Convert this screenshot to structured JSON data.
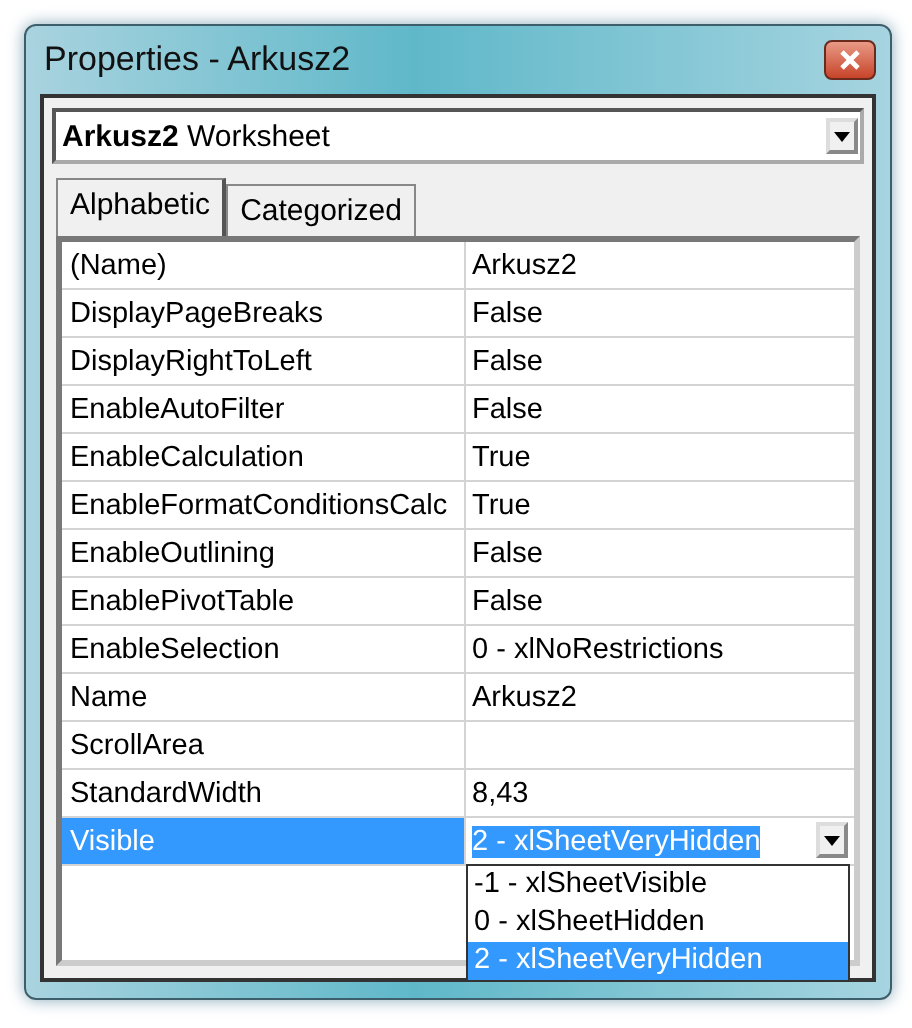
{
  "window": {
    "title": "Properties - Arkusz2"
  },
  "object_selector": {
    "name": "Arkusz2",
    "type": "Worksheet"
  },
  "tabs": [
    {
      "label": "Alphabetic",
      "selected": true
    },
    {
      "label": "Categorized",
      "selected": false
    }
  ],
  "properties": [
    {
      "name": "(Name)",
      "value": "Arkusz2",
      "selected": false
    },
    {
      "name": "DisplayPageBreaks",
      "value": "False",
      "selected": false
    },
    {
      "name": "DisplayRightToLeft",
      "value": "False",
      "selected": false
    },
    {
      "name": "EnableAutoFilter",
      "value": "False",
      "selected": false
    },
    {
      "name": "EnableCalculation",
      "value": "True",
      "selected": false
    },
    {
      "name": "EnableFormatConditionsCalc",
      "value": "True",
      "selected": false
    },
    {
      "name": "EnableOutlining",
      "value": "False",
      "selected": false
    },
    {
      "name": "EnablePivotTable",
      "value": "False",
      "selected": false
    },
    {
      "name": "EnableSelection",
      "value": "0 - xlNoRestrictions",
      "selected": false
    },
    {
      "name": "Name",
      "value": "Arkusz2",
      "selected": false
    },
    {
      "name": "ScrollArea",
      "selected": false
    },
    {
      "name": "StandardWidth",
      "value": "8,43",
      "selected": false
    },
    {
      "name": "Visible",
      "value": "2 - xlSheetVeryHidden",
      "selected": true,
      "options": [
        {
          "label": "-1 - xlSheetVisible",
          "selected": false
        },
        {
          "label": "0 - xlSheetHidden",
          "selected": false
        },
        {
          "label": "2 - xlSheetVeryHidden",
          "selected": true
        }
      ]
    }
  ]
}
